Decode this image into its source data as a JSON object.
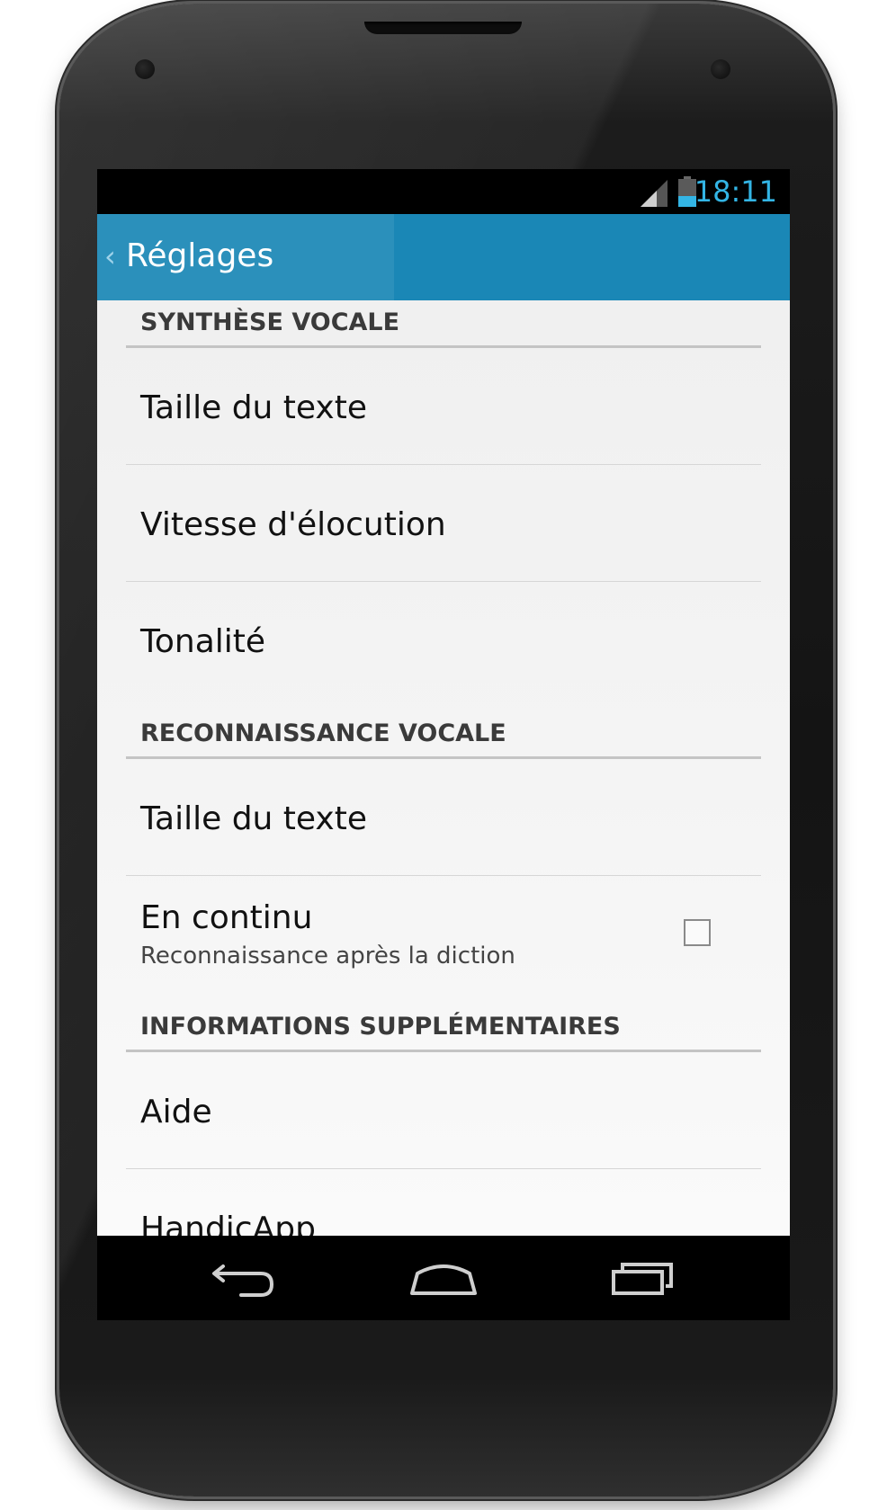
{
  "status_bar": {
    "time": "18:11",
    "signal_icon": "signal-icon",
    "battery_icon": "battery-icon",
    "accent_color": "#33b5e5"
  },
  "action_bar": {
    "title": "Réglages",
    "back_glyph": "‹",
    "color": "#1a87b6"
  },
  "sections": [
    {
      "header": "SYNTHÈSE VOCALE",
      "items": [
        {
          "title": "Taille du texte"
        },
        {
          "title": "Vitesse d'élocution"
        },
        {
          "title": "Tonalité"
        }
      ]
    },
    {
      "header": "RECONNAISSANCE VOCALE",
      "items": [
        {
          "title": "Taille du texte"
        },
        {
          "title": "En continu",
          "summary": "Reconnaissance après la diction",
          "checked": false
        }
      ]
    },
    {
      "header": "INFORMATIONS SUPPLÉMENTAIRES",
      "items": [
        {
          "title": "Aide"
        },
        {
          "title": "HandicApp"
        }
      ]
    }
  ],
  "nav_bar": {
    "buttons": [
      "back-icon",
      "home-icon",
      "recents-icon"
    ]
  }
}
